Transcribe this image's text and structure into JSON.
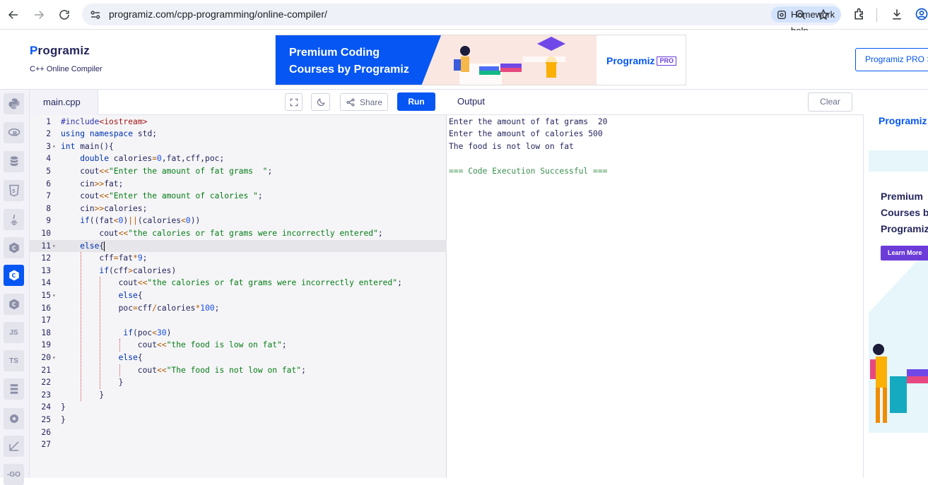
{
  "browser": {
    "url": "programiz.com/cpp-programming/online-compiler/",
    "chip_label": "Homework help"
  },
  "header": {
    "logo_text": "rogramiz",
    "logo_p": "P",
    "subtitle": "C++ Online Compiler",
    "banner_line1": "Premium Coding",
    "banner_line2": "Courses by Programiz",
    "banner_pro_logo": "rogramiz",
    "banner_pro_p": "P",
    "banner_pro_tag": "PRO",
    "pro_button": "Programiz PRO >"
  },
  "sidebar": {
    "languages": [
      "python",
      "r",
      "sql",
      "html",
      "java",
      "c",
      "cpp",
      "csharp",
      "js",
      "ts",
      "go-db",
      "rust",
      "kotlin",
      "go"
    ],
    "labels": {
      "js": "JS",
      "ts": "TS",
      "go": "-GO"
    },
    "active": "cpp"
  },
  "editor": {
    "tab_label": "main.cpp",
    "share_label": "Share",
    "run_label": "Run",
    "active_line": 11,
    "lines": [
      {
        "n": "1",
        "fold": "",
        "indent": 0,
        "text": "#include<iostream>"
      },
      {
        "n": "2",
        "fold": "",
        "indent": 0,
        "text": "using namespace std;"
      },
      {
        "n": "3",
        "fold": "▾",
        "indent": 0,
        "text": "int main(){"
      },
      {
        "n": "4",
        "fold": "",
        "indent": 1,
        "text": "double calories=0,fat,cff,poc;"
      },
      {
        "n": "5",
        "fold": "",
        "indent": 1,
        "text": "cout<<\"Enter the amount of fat grams  \";"
      },
      {
        "n": "6",
        "fold": "",
        "indent": 1,
        "text": "cin>>fat;"
      },
      {
        "n": "7",
        "fold": "",
        "indent": 1,
        "text": "cout<<\"Enter the amount of calories \";"
      },
      {
        "n": "8",
        "fold": "",
        "indent": 1,
        "text": "cin>>calories;"
      },
      {
        "n": "9",
        "fold": "",
        "indent": 1,
        "text": "if((fat<0)||(calories<0))"
      },
      {
        "n": "10",
        "fold": "",
        "indent": 2,
        "text": "cout<<\"the calories or fat grams were incorrectly entered\";"
      },
      {
        "n": "11",
        "fold": "▾",
        "indent": 1,
        "text": "else{"
      },
      {
        "n": "12",
        "fold": "",
        "indent": 2,
        "text": "cff=fat*9;"
      },
      {
        "n": "13",
        "fold": "",
        "indent": 2,
        "text": "if(cff>calories)"
      },
      {
        "n": "14",
        "fold": "",
        "indent": 3,
        "text": "cout<<\"the calories or fat grams were incorrectly entered\";"
      },
      {
        "n": "15",
        "fold": "▾",
        "indent": 3,
        "text": "else{"
      },
      {
        "n": "16",
        "fold": "",
        "indent": 3,
        "text": "poc=cff/calories*100;"
      },
      {
        "n": "17",
        "fold": "",
        "indent": 0,
        "text": ""
      },
      {
        "n": "18",
        "fold": "",
        "indent": 3,
        "text": " if(poc<30)"
      },
      {
        "n": "19",
        "fold": "",
        "indent": 4,
        "text": "cout<<\"the food is low on fat\";"
      },
      {
        "n": "20",
        "fold": "▾",
        "indent": 3,
        "text": "else{"
      },
      {
        "n": "21",
        "fold": "",
        "indent": 4,
        "text": "cout<<\"The food is not low on fat\";"
      },
      {
        "n": "22",
        "fold": "",
        "indent": 3,
        "text": "}"
      },
      {
        "n": "23",
        "fold": "",
        "indent": 2,
        "text": "}"
      },
      {
        "n": "24",
        "fold": "",
        "indent": 0,
        "text": "}"
      },
      {
        "n": "25",
        "fold": "",
        "indent": 0,
        "text": "}"
      },
      {
        "n": "26",
        "fold": "",
        "indent": 0,
        "text": ""
      },
      {
        "n": "27",
        "fold": "",
        "indent": 0,
        "text": ""
      }
    ]
  },
  "output": {
    "title": "Output",
    "clear_label": "Clear",
    "lines": [
      {
        "text": "Enter the amount of fat grams  20",
        "kind": "normal"
      },
      {
        "text": "Enter the amount of calories 500",
        "kind": "normal"
      },
      {
        "text": "The food is not low on fat",
        "kind": "normal"
      },
      {
        "text": "",
        "kind": "normal"
      },
      {
        "text": "=== Code Execution Successful ===",
        "kind": "success"
      }
    ]
  },
  "side_ad": {
    "logo_p": "P",
    "logo_text": "rogramiz",
    "text": "Premium\nCourses b\nProgramiz",
    "cta": "Learn More"
  },
  "colors": {
    "brand": "#0556f3",
    "purple": "#6c3cd9",
    "success": "#3a8f4e"
  }
}
